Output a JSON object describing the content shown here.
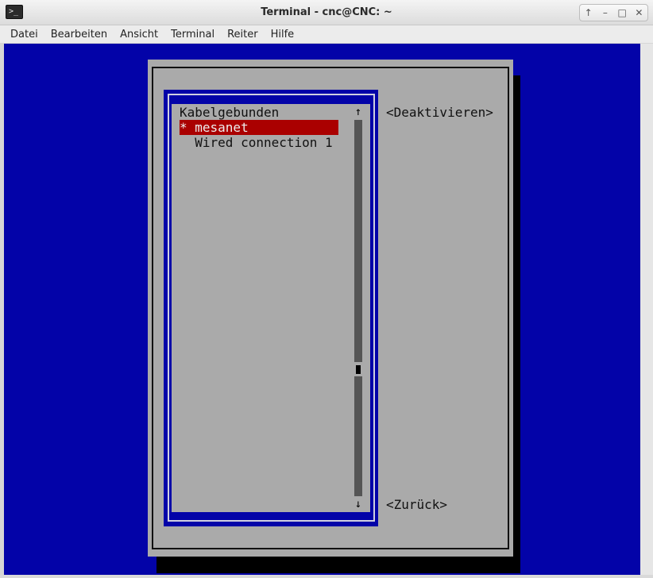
{
  "window": {
    "title": "Terminal - cnc@CNC: ~",
    "app_icon": "terminal-icon",
    "controls": {
      "shade": "↑",
      "minimize": "–",
      "maximize": "□",
      "close": "✕"
    }
  },
  "menubar": {
    "items": [
      "Datei",
      "Bearbeiten",
      "Ansicht",
      "Terminal",
      "Reiter",
      "Hilfe"
    ]
  },
  "nmtui": {
    "list": {
      "group_header": "Kabelgebunden",
      "items": [
        {
          "label": "* mesanet",
          "selected": true
        },
        {
          "label": "  Wired connection 1",
          "selected": false
        }
      ],
      "scroll_up": "↑",
      "scroll_down": "↓"
    },
    "buttons": {
      "deactivate": "<Deaktivieren>",
      "back": "<Zurück>"
    }
  },
  "colors": {
    "terminal_bg": "#0303a8",
    "dialog_bg": "#aaaaaa",
    "selection_bg": "#aa0000",
    "selection_fg": "#eeeeee"
  }
}
